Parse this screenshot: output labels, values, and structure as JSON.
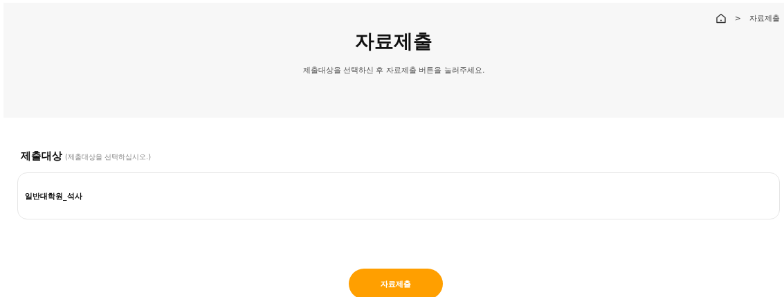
{
  "breadcrumb": {
    "separator": ">",
    "current": "자료제출"
  },
  "header": {
    "title": "자료제출",
    "subtitle": "제출대상을 선택하신 후 자료제출 버튼을 눌러주세요."
  },
  "target": {
    "label": "제출대상",
    "hint": "(제출대상을 선택하십시오.)",
    "options": [
      {
        "label": "일반대학원_석사"
      }
    ]
  },
  "submit_button": "자료제출"
}
